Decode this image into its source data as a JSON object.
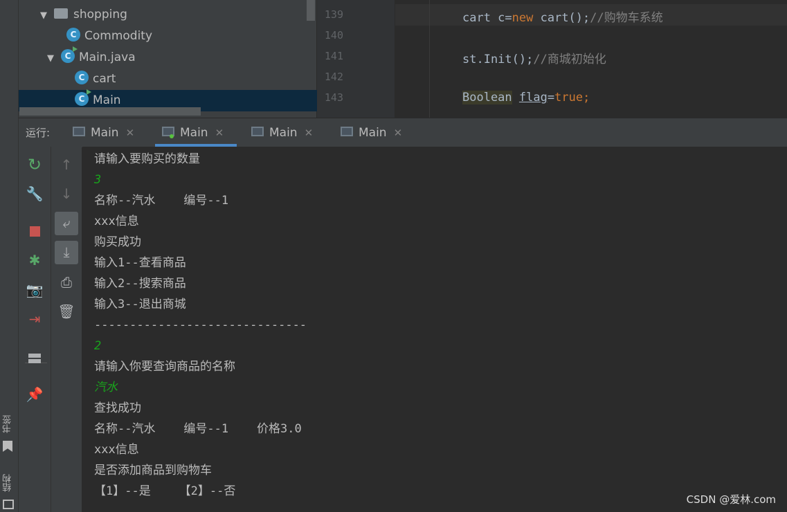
{
  "left_stripe": {
    "bookmarks_label": "书签",
    "structure_label": "结构"
  },
  "project_tree": {
    "items": [
      {
        "label": "shopping",
        "kind": "folder",
        "expanded": true
      },
      {
        "label": "Commodity",
        "kind": "class"
      },
      {
        "label": "Main.java",
        "kind": "file",
        "expanded": true
      },
      {
        "label": "cart",
        "kind": "class"
      },
      {
        "label": "Main",
        "kind": "class",
        "selected": true
      }
    ]
  },
  "editor": {
    "line_numbers": [
      "139",
      "140",
      "141",
      "142",
      "143"
    ],
    "lines": {
      "l139": {
        "a": "cart c=",
        "kw": "new",
        "b": " cart();",
        "comment": "//购物车系统"
      },
      "l141": {
        "a": "st.Init();",
        "comment": "//商城初始化"
      },
      "l143": {
        "type": "Boolean",
        "var": "flag",
        "eq": "=",
        "val": "true",
        "end": ";"
      }
    }
  },
  "run_window": {
    "label": "运行:",
    "tabs": [
      {
        "label": "Main",
        "active": false
      },
      {
        "label": "Main",
        "active": true
      },
      {
        "label": "Main",
        "active": false
      },
      {
        "label": "Main",
        "active": false
      }
    ],
    "toolbar_left": [
      "rerun-icon",
      "wrench-icon",
      "stop-icon",
      "debug-icon",
      "camera-icon",
      "exit-icon",
      "layout-icon",
      "pin-icon"
    ],
    "toolbar_right": [
      "up-arrow-icon",
      "down-arrow-icon",
      "soft-wrap-icon",
      "scroll-to-end-icon",
      "print-icon",
      "trash-icon"
    ]
  },
  "console": {
    "lines": [
      {
        "text": "请输入要购买的数量",
        "input": false
      },
      {
        "text": "3",
        "input": true
      },
      {
        "text": "名称--汽水    编号--1",
        "input": false
      },
      {
        "text": "xxx信息",
        "input": false
      },
      {
        "text": "购买成功",
        "input": false
      },
      {
        "text": "输入1--查看商品",
        "input": false
      },
      {
        "text": "输入2--搜索商品",
        "input": false
      },
      {
        "text": "输入3--退出商城",
        "input": false
      },
      {
        "text": "------------------------------",
        "input": false
      },
      {
        "text": "2",
        "input": true
      },
      {
        "text": "请输入你要查询商品的名称",
        "input": false
      },
      {
        "text": "汽水",
        "input": true
      },
      {
        "text": "查找成功",
        "input": false
      },
      {
        "text": "名称--汽水    编号--1    价格3.0",
        "input": false
      },
      {
        "text": "xxx信息",
        "input": false
      },
      {
        "text": "是否添加商品到购物车",
        "input": false
      },
      {
        "text": "【1】--是    【2】--否",
        "input": false
      }
    ]
  },
  "watermark": "CSDN @爱林.com"
}
